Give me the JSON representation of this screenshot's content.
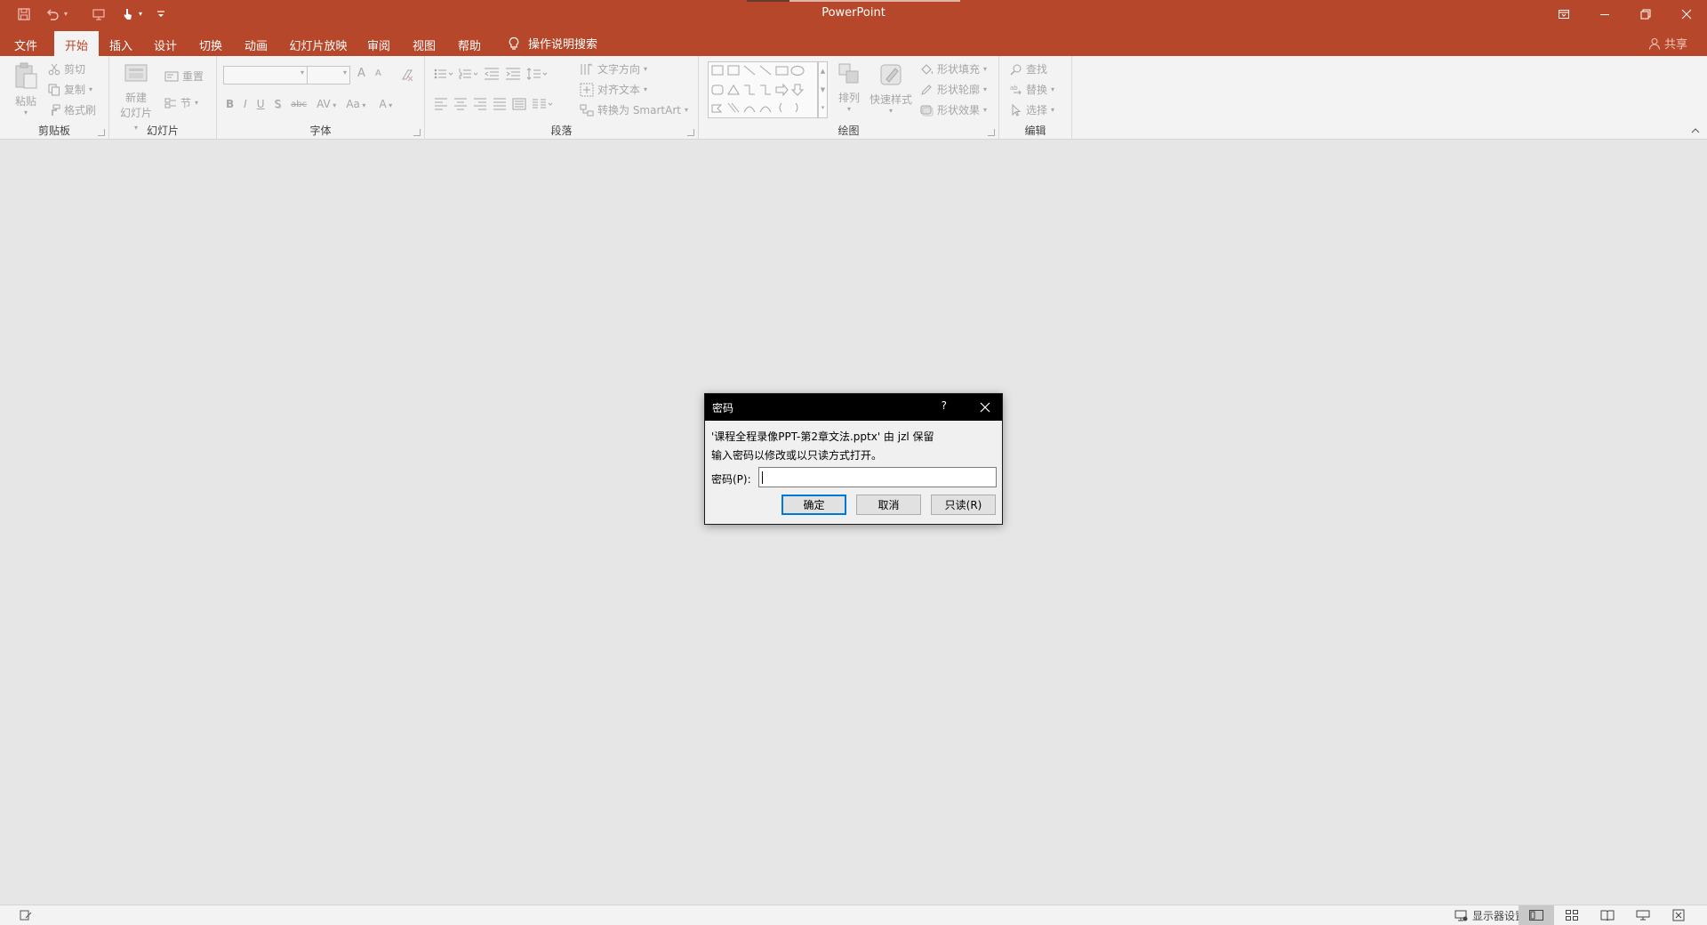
{
  "app": {
    "title": "PowerPoint"
  },
  "colors": {
    "brand": "#b7472a",
    "ribbon_bg": "#f3f3f3",
    "workspace": "#e6e6e6",
    "focus_blue": "#0078d7"
  },
  "tabs": [
    {
      "label": "文件",
      "active": false
    },
    {
      "label": "开始",
      "active": true
    },
    {
      "label": "插入",
      "active": false
    },
    {
      "label": "设计",
      "active": false
    },
    {
      "label": "切换",
      "active": false
    },
    {
      "label": "动画",
      "active": false
    },
    {
      "label": "幻灯片放映",
      "active": false
    },
    {
      "label": "审阅",
      "active": false
    },
    {
      "label": "视图",
      "active": false
    },
    {
      "label": "帮助",
      "active": false
    }
  ],
  "tell_me": "操作说明搜索",
  "share": "共享",
  "ribbon": {
    "clipboard": {
      "label": "剪贴板",
      "paste": "粘贴",
      "cut": "剪切",
      "copy": "复制",
      "format_painter": "格式刷"
    },
    "slides": {
      "label": "幻灯片",
      "new_slide_1": "新建",
      "new_slide_2": "幻灯片",
      "reset": "重置",
      "section": "节"
    },
    "font": {
      "label": "字体",
      "bold": "B",
      "italic": "I",
      "underline": "U",
      "shadow": "S",
      "strike": "abc",
      "spacing": "AV",
      "case": "Aa",
      "color": "A",
      "grow": "A",
      "shrink": "A"
    },
    "paragraph": {
      "label": "段落",
      "text_direction": "文字方向",
      "align_text": "对齐文本",
      "smartart": "转换为 SmartArt"
    },
    "drawing": {
      "label": "绘图",
      "arrange": "排列",
      "quick_styles": "快速样式",
      "shape_fill": "形状填充",
      "shape_outline": "形状轮廓",
      "shape_effects": "形状效果"
    },
    "editing": {
      "label": "编辑",
      "find": "查找",
      "replace": "替换",
      "select": "选择"
    }
  },
  "dialog": {
    "title": "密码",
    "help": "?",
    "line1": "'课程全程录像PPT-第2章文法.pptx' 由 jzl 保留",
    "line2": "输入密码以修改或以只读方式打开。",
    "password_label": "密码(P):",
    "password_value": "",
    "ok": "确定",
    "cancel": "取消",
    "readonly": "只读(R)"
  },
  "status": {
    "display_settings": "显示器设置"
  }
}
